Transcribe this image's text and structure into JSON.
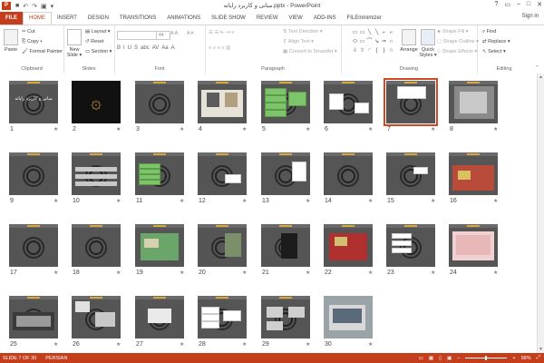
{
  "window": {
    "title": "مبانی و کاربرد رایانه.pptx - PowerPoint",
    "controls": [
      "?",
      "▭",
      "–",
      "□",
      "✕"
    ],
    "sign_in": "Sign in"
  },
  "ribbon_tabs": [
    "FILE",
    "HOME",
    "INSERT",
    "DESIGN",
    "TRANSITIONS",
    "ANIMATIONS",
    "SLIDE SHOW",
    "REVIEW",
    "VIEW",
    "ADD-INS",
    "FILEminimizer"
  ],
  "active_tab": "HOME",
  "ribbon": {
    "clipboard": {
      "label": "Clipboard",
      "paste": "Paste",
      "cut": "Cut",
      "copy": "Copy ▾",
      "format_painter": "Format Painter"
    },
    "slides": {
      "label": "Slides",
      "new_slide": "New Slide ▾",
      "layout": "Layout ▾",
      "reset": "Reset",
      "section": "Section ▾"
    },
    "font": {
      "label": "Font",
      "font_size": "44",
      "format_buttons": [
        "B",
        "I",
        "U",
        "S",
        "abc",
        "AV",
        "Aa",
        "A"
      ]
    },
    "paragraph": {
      "label": "Paragraph",
      "text_direction": "Text Direction ▾",
      "align_text": "Align Text ▾",
      "convert_smartart": "Convert to SmartArt ▾"
    },
    "drawing": {
      "label": "Drawing",
      "arrange": "Arrange",
      "quick_styles": "Quick Styles ▾",
      "shape_fill": "Shape Fill ▾",
      "shape_outline": "Shape Outline ▾",
      "shape_effects": "Shape Effects ▾",
      "shapes": [
        "▭",
        "▭",
        "╲",
        "╲",
        "⌐",
        "⌐",
        "⬭",
        "▭",
        "⌒",
        "↘",
        "⇒",
        "∩",
        "⇩",
        "⇧",
        "◜",
        "{",
        "}",
        "☆"
      ]
    },
    "editing": {
      "label": "Editing",
      "find": "Find",
      "replace": "Replace ▾",
      "select": "Select ▾"
    }
  },
  "slides": [
    {
      "number": "1",
      "title": "مبانی و کاربرد رایانه"
    },
    {
      "number": "2"
    },
    {
      "number": "3"
    },
    {
      "number": "4"
    },
    {
      "number": "5"
    },
    {
      "number": "6"
    },
    {
      "number": "7",
      "selected": true
    },
    {
      "number": "8"
    },
    {
      "number": "9"
    },
    {
      "number": "10"
    },
    {
      "number": "11"
    },
    {
      "number": "12"
    },
    {
      "number": "13"
    },
    {
      "number": "14"
    },
    {
      "number": "15"
    },
    {
      "number": "16"
    },
    {
      "number": "17"
    },
    {
      "number": "18"
    },
    {
      "number": "19"
    },
    {
      "number": "20"
    },
    {
      "number": "21"
    },
    {
      "number": "22"
    },
    {
      "number": "23"
    },
    {
      "number": "24"
    },
    {
      "number": "25"
    },
    {
      "number": "26"
    },
    {
      "number": "27"
    },
    {
      "number": "28"
    },
    {
      "number": "29"
    },
    {
      "number": "30"
    }
  ],
  "status": {
    "slide_info": "SLIDE 7 OF 30",
    "language": "PERSIAN",
    "zoom": "58%",
    "zoom_fraction": 0.5
  },
  "colors": {
    "accent": "#c43e1c",
    "selected_outline": "#d24726"
  }
}
